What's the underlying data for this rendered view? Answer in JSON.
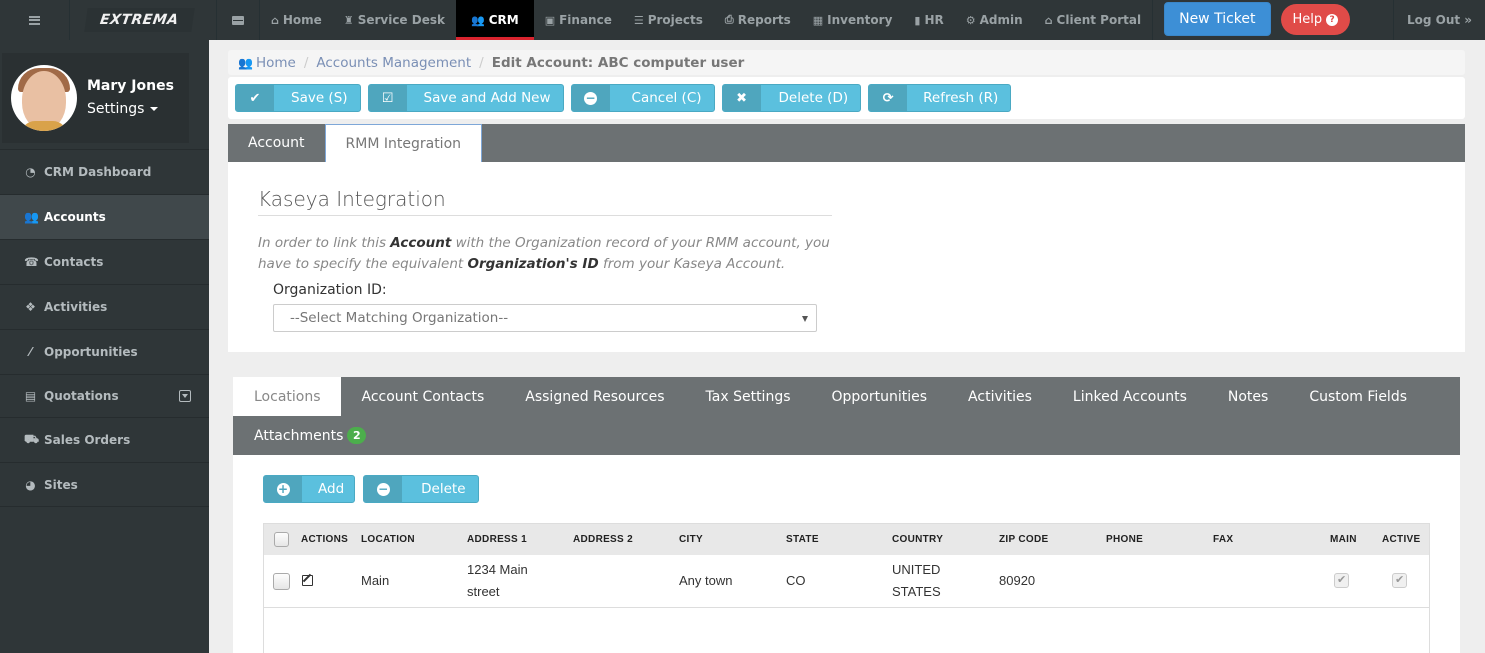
{
  "topnav": {
    "logo": "EXTREMA",
    "items": [
      {
        "label": "Home",
        "icon": "home-icon",
        "glyph": "⌂"
      },
      {
        "label": "Service Desk",
        "icon": "sitemap-icon",
        "glyph": "♜"
      },
      {
        "label": "CRM",
        "icon": "users-icon",
        "glyph": "👥",
        "active": true
      },
      {
        "label": "Finance",
        "icon": "money-icon",
        "glyph": "▣"
      },
      {
        "label": "Projects",
        "icon": "tasks-icon",
        "glyph": "☰"
      },
      {
        "label": "Reports",
        "icon": "print-icon",
        "glyph": "⎙"
      },
      {
        "label": "Inventory",
        "icon": "building-icon",
        "glyph": "▦"
      },
      {
        "label": "HR",
        "icon": "briefcase-icon",
        "glyph": "▮"
      },
      {
        "label": "Admin",
        "icon": "gear-icon",
        "glyph": "⚙"
      },
      {
        "label": "Client Portal",
        "icon": "home-icon",
        "glyph": "⌂"
      }
    ],
    "new_ticket": "New Ticket",
    "help": "Help",
    "help_glyph": "?",
    "logout": "Log Out »"
  },
  "sidebar": {
    "user_name": "Mary Jones",
    "settings_label": "Settings",
    "items": [
      {
        "label": "CRM Dashboard",
        "icon": "dashboard-icon",
        "glyph": "◔"
      },
      {
        "label": "Accounts",
        "icon": "users-icon",
        "glyph": "👥",
        "active": true
      },
      {
        "label": "Contacts",
        "icon": "phone-icon",
        "glyph": "☎"
      },
      {
        "label": "Activities",
        "icon": "cubes-icon",
        "glyph": "❖"
      },
      {
        "label": "Opportunities",
        "icon": "magic-wand-icon",
        "glyph": "⁄"
      },
      {
        "label": "Quotations",
        "icon": "file-text-icon",
        "glyph": "▤",
        "expandable": true
      },
      {
        "label": "Sales Orders",
        "icon": "cart-icon",
        "glyph": "⛟"
      },
      {
        "label": "Sites",
        "icon": "globe-icon",
        "glyph": "◕"
      }
    ]
  },
  "breadcrumb": {
    "items": [
      "Home",
      "Accounts Management"
    ],
    "current": "Edit Account: ABC computer user",
    "separator": "/"
  },
  "toolbar": {
    "save": "Save (S)",
    "save_add_new": "Save and Add New",
    "cancel": "Cancel (C)",
    "delete": "Delete (D)",
    "refresh": "Refresh (R)"
  },
  "account_tabs": {
    "items": [
      "Account",
      "RMM Integration"
    ],
    "active": "RMM Integration"
  },
  "rmm": {
    "title": "Kaseya Integration",
    "help_1": "In order to link this ",
    "help_b1": "Account",
    "help_2": " with the Organization record of your RMM account, you have to specify the equivalent ",
    "help_b2": "Organization's ID",
    "help_3": " from your Kaseya Account.",
    "org_label": "Organization ID:",
    "org_select_value": "--Select Matching Organization--"
  },
  "sub_tabs": {
    "items": [
      "Locations",
      "Account Contacts",
      "Assigned Resources",
      "Tax Settings",
      "Opportunities",
      "Activities",
      "Linked Accounts",
      "Notes",
      "Custom Fields"
    ],
    "attachments_label": "Attachments",
    "attachments_count": "2",
    "active": "Locations"
  },
  "locations": {
    "add": "Add",
    "delete": "Delete",
    "columns": [
      "ACTIONS",
      "LOCATION",
      "ADDRESS 1",
      "ADDRESS 2",
      "CITY",
      "STATE",
      "COUNTRY",
      "ZIP CODE",
      "PHONE",
      "FAX",
      "MAIN",
      "ACTIVE"
    ],
    "rows": [
      {
        "location": "Main",
        "address1_line1": "1234 Main",
        "address1_line2": "street",
        "address2": "",
        "city": "Any town",
        "state": "CO",
        "country_line1": "UNITED",
        "country_line2": "STATES",
        "zip": "80920",
        "phone": "",
        "fax": "",
        "main": true,
        "active": true
      }
    ]
  },
  "colors": {
    "topnav_bg": "#2f3638",
    "crm_active_underline": "#d9232e",
    "new_ticket": "#3d8fd6",
    "help": "#e04b48",
    "button_info": "#5bc0de",
    "tab_bar": "#6c7173",
    "badge": "#4cae4c"
  }
}
